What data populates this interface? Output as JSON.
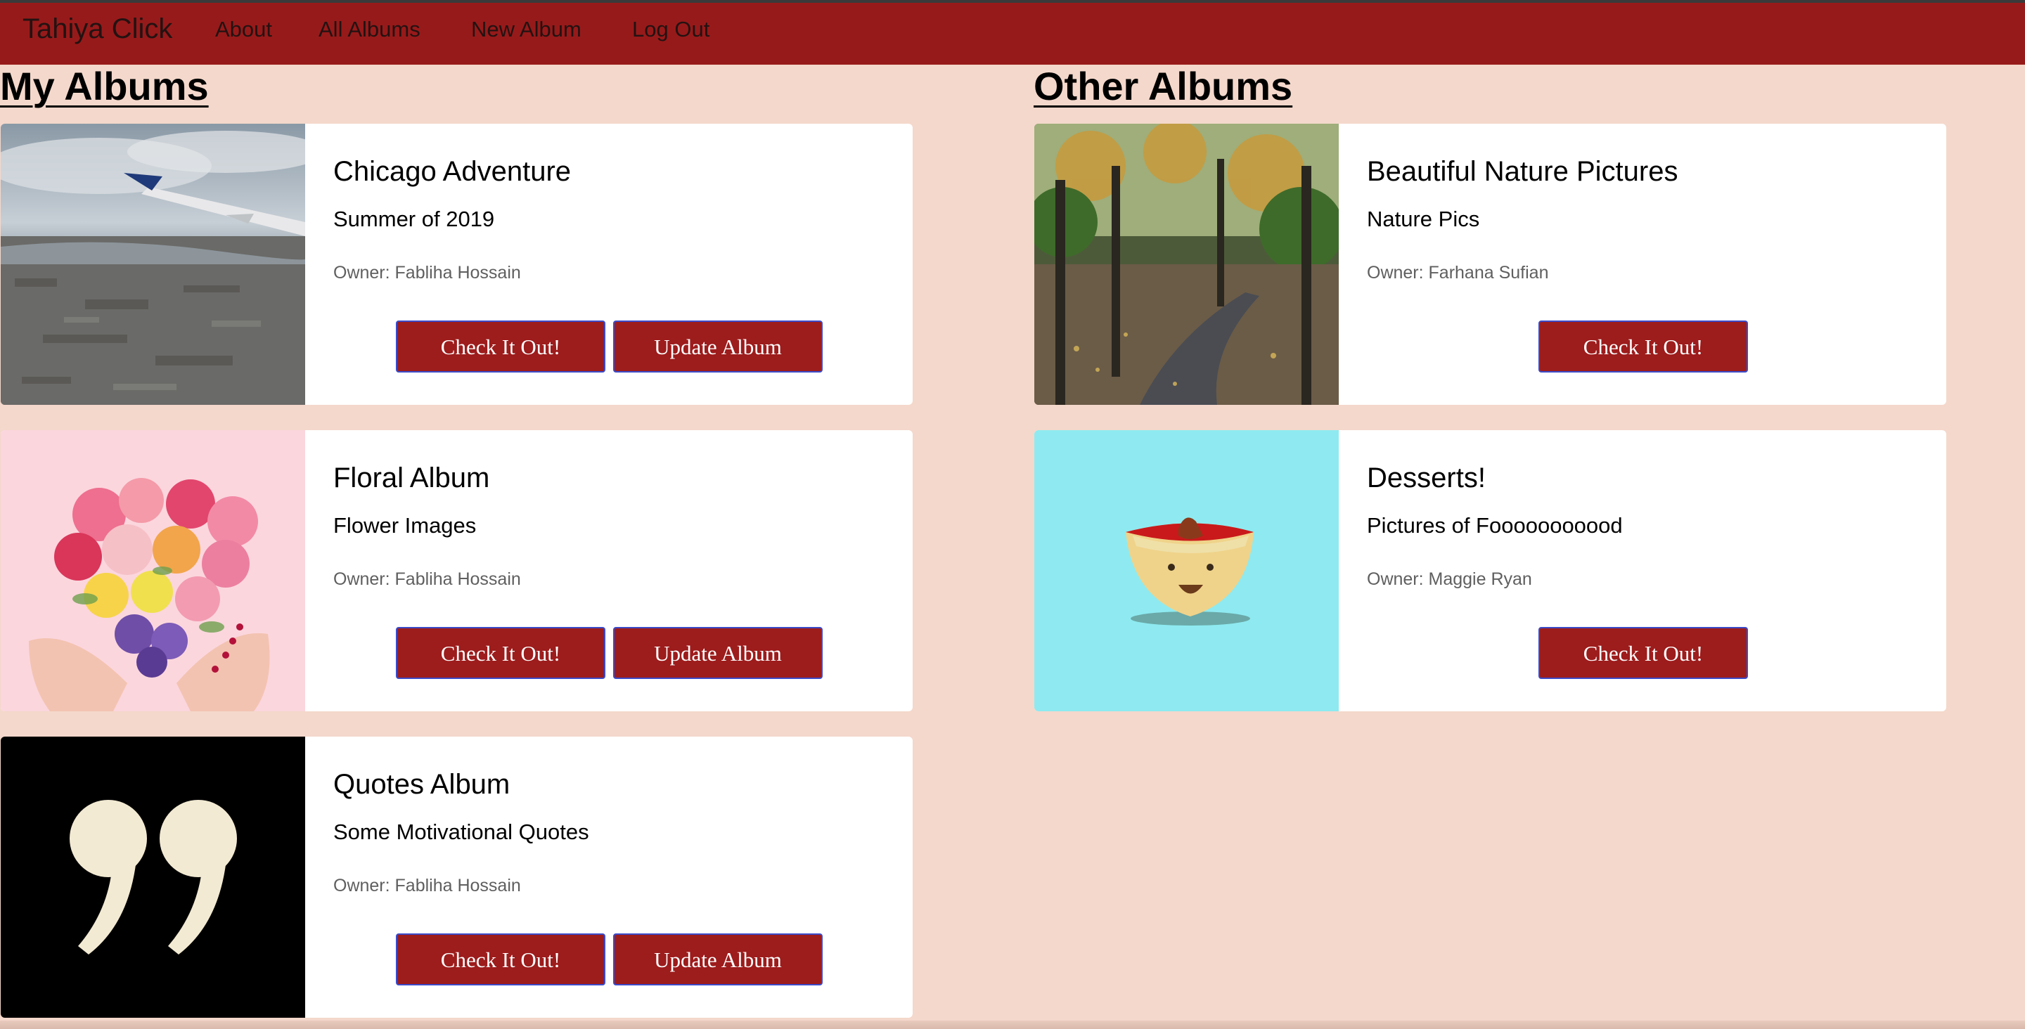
{
  "navbar": {
    "brand": "Tahiya Click",
    "links": [
      "About",
      "All Albums",
      "New Album",
      "Log Out"
    ]
  },
  "my_albums": {
    "heading": "My Albums",
    "cards": [
      {
        "title": "Chicago Adventure",
        "subtitle": "Summer of 2019",
        "owner": "Owner: Fabliha Hossain",
        "check_label": "Check It Out!",
        "update_label": "Update Album",
        "image": "aerial-city-from-airplane-wing"
      },
      {
        "title": "Floral Album",
        "subtitle": "Flower Images",
        "owner": "Owner: Fabliha Hossain",
        "check_label": "Check It Out!",
        "update_label": "Update Album",
        "image": "flower-heart-held-in-hands"
      },
      {
        "title": "Quotes Album",
        "subtitle": "Some Motivational Quotes",
        "owner": "Owner: Fabliha Hossain",
        "check_label": "Check It Out!",
        "update_label": "Update Album",
        "image": "quotation-marks-on-black"
      }
    ]
  },
  "other_albums": {
    "heading": "Other Albums",
    "cards": [
      {
        "title": "Beautiful Nature Pictures",
        "subtitle": "Nature Pics",
        "owner": "Owner: Farhana Sufian",
        "check_label": "Check It Out!",
        "image": "autumn-park-path"
      },
      {
        "title": "Desserts!",
        "subtitle": "Pictures of Fooooooooood",
        "owner": "Owner: Maggie Ryan",
        "check_label": "Check It Out!",
        "image": "cartoon-smiling-bowl"
      }
    ]
  },
  "colors": {
    "navbar": "#971a1a",
    "background": "#f4d8cb",
    "button": "#9d1c1c",
    "button_border": "#3b4bc9"
  }
}
